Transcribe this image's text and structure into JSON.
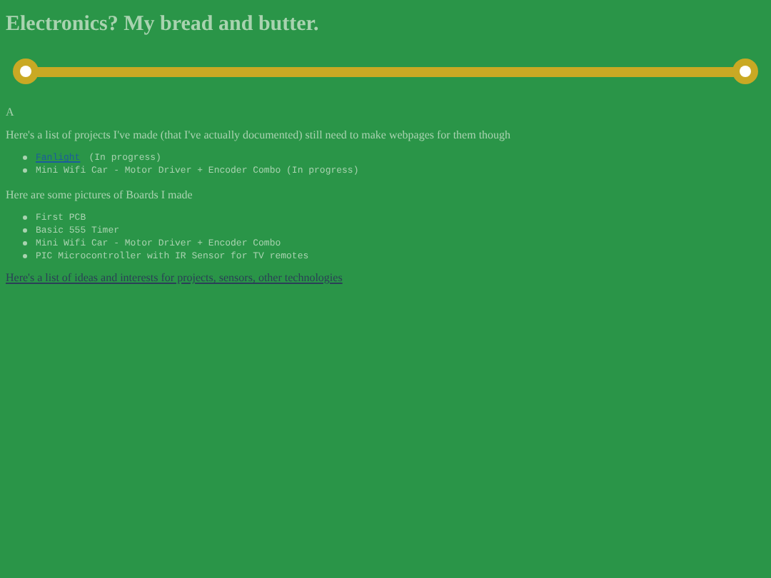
{
  "title": "Electronics? My bread and butter.",
  "intro": "A",
  "projects_heading": "Here's a list of projects I've made (that I've actually documented) still need to make webpages for them though",
  "projects": [
    {
      "kind": "link",
      "link": "Fanlight",
      "text": "(In progress)"
    },
    {
      "kind": "text",
      "text": "Mini Wifi Car - Motor Driver + Encoder Combo (In progress)"
    }
  ],
  "boards_heading": "Here are some pictures of Boards I made",
  "boards": [
    {
      "kind": "text",
      "text": "First PCB"
    },
    {
      "kind": "text",
      "text": "Basic 555 Timer"
    },
    {
      "kind": "text",
      "text": "Mini Wifi Car - Motor Driver + Encoder Combo"
    },
    {
      "kind": "text",
      "text": "PIC Microcontroller with IR Sensor for TV remotes"
    }
  ],
  "ideas_link": "Here's a list of ideas and interests for projects, sensors, other technologies"
}
